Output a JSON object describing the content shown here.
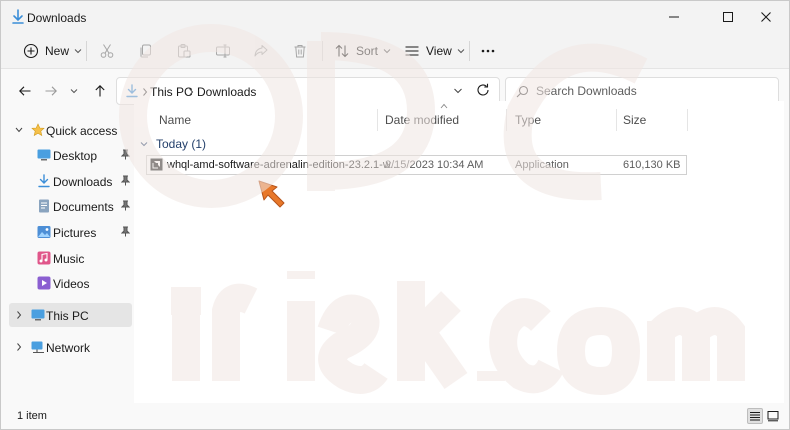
{
  "window": {
    "title": "Downloads"
  },
  "commandbar": {
    "new_label": "New",
    "sort_label": "Sort",
    "view_label": "View"
  },
  "address": {
    "crumbs": [
      "This PC",
      "Downloads"
    ],
    "search_placeholder": "Search Downloads"
  },
  "navpane": {
    "quick_access": "Quick access",
    "items": [
      {
        "label": "Desktop",
        "icon": "desktop-icon",
        "pinned": true
      },
      {
        "label": "Downloads",
        "icon": "download-icon",
        "pinned": true
      },
      {
        "label": "Documents",
        "icon": "documents-icon",
        "pinned": true
      },
      {
        "label": "Pictures",
        "icon": "pictures-icon",
        "pinned": true
      },
      {
        "label": "Music",
        "icon": "music-icon",
        "pinned": false
      },
      {
        "label": "Videos",
        "icon": "videos-icon",
        "pinned": false
      }
    ],
    "this_pc": "This PC",
    "network": "Network"
  },
  "columns": {
    "name": "Name",
    "date": "Date modified",
    "type": "Type",
    "size": "Size"
  },
  "group": {
    "label": "Today (1)"
  },
  "files": [
    {
      "name": "whql-amd-software-adrenalin-edition-23.2.1-w...",
      "date": "2/15/2023 10:34 AM",
      "type": "Application",
      "size": "610,130 KB"
    }
  ],
  "status": {
    "count": "1 item"
  },
  "colors": {
    "accent": "#0067c0",
    "folder": "#f5c04a",
    "arrow": "#e8782a",
    "group_text": "#24406b"
  }
}
